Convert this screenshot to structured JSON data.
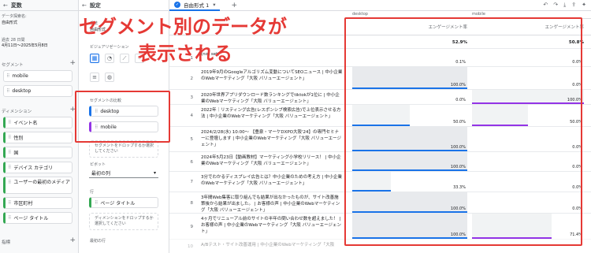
{
  "variables_panel": {
    "title": "変数",
    "exploration_name_label": "データ探索名:",
    "exploration_name": "自由形式",
    "date_label": "過去 28 日間",
    "date_range": "4月11日～2025年5月8日",
    "segments_label": "セグメント",
    "segments": [
      "mobile",
      "desktop"
    ],
    "dimensions_label": "ディメンション",
    "dimensions": [
      "イベント名",
      "性別",
      "国",
      "デバイス カテゴリ",
      "ユーザーの最初のメディア",
      "市区町村",
      "ページ タイトル"
    ],
    "metrics_label": "指標"
  },
  "settings_panel": {
    "title": "設定",
    "technique_label": "手法",
    "technique_value": "自由形式",
    "viz_label": "ビジュアリゼーション",
    "segment_compare_label": "セグメントの比較",
    "segment_compare": [
      "desktop",
      "mobile"
    ],
    "segment_drop_hint": "セグメントをドロップするか選択してください",
    "pivot_label": "ピボット",
    "pivot_value": "最初の列",
    "rows_label": "行",
    "rows_item": "ページ タイトル",
    "rows_drop_hint": "ディメンションをドロップするか選択してください",
    "start_row_label": "最初の行"
  },
  "canvas": {
    "tab_label": "自由形式 1",
    "toolbar_icons": [
      "undo-icon",
      "redo-icon",
      "download-icon",
      "share-icon",
      "insights-icon"
    ],
    "segments": [
      "desktop",
      "mobile"
    ],
    "metric_label": "エンゲージメント率",
    "totals": [
      "52.9%",
      "50.8%"
    ],
    "rows": [
      {
        "num": "1",
        "title": "(not set)",
        "desktop": "0.1%",
        "mobile": "0.0%"
      },
      {
        "num": "2",
        "title": "2019年9月のGoogleアルゴリズム変動についてSEOニュース | 中小企業のWebマーケティング「大阪 バリューエージェント」",
        "desktop": "100.0%",
        "mobile": "0.0%"
      },
      {
        "num": "3",
        "title": "2020年世界アプリダウンロード数ランキングでtiktokが1位に | 中小企業のWebマーケティング「大阪 バリューエージェント」",
        "desktop": "0.0%",
        "mobile": "100.0%"
      },
      {
        "num": "4",
        "title": "2022年｜リスティング広告(レスポンシブ検索広告)で上位表示させる方法 | 中小企業のWebマーケティング「大阪 バリューエージェント」",
        "desktop": "50.0%",
        "mobile": "50.0%"
      },
      {
        "num": "5",
        "title": "2024/2/28(水) 10:00～ 【豊泉・マーケDXPO大阪'24】の専門セミナーに登壇します | 中小企業のWebマーケティング「大阪 バリューエージェント」",
        "desktop": "100.0%",
        "mobile": "0.0%"
      },
      {
        "num": "6",
        "title": "2024年5月23日【動画教材】マーケティング小学校リリース！ | 中小企業のWebマーケティング「大阪 バリューエージェント」",
        "desktop": "100.0%",
        "mobile": "0.0%"
      },
      {
        "num": "7",
        "title": "3分でわかるディスプレイ広告とは？中小企業のための考え方 | 中小企業のWebマーケティング「大阪 バリューエージェント」",
        "desktop": "33.3%",
        "mobile": "0.0%"
      },
      {
        "num": "8",
        "title": "3年間Web集客に取り組んでも結果が出なかったものが、サイト改善施策後から結果が出ました。 | お客様の声 | 中小企業のWebマーケティング「大阪 バリューエージェント」",
        "desktop": "100.0%",
        "mobile": "0.0%"
      },
      {
        "num": "9",
        "title": "4ヶ月でリニューアル前のサイトの半年の問い合わせ数を超えました！ | お客様の声 | 中小企業のWebマーケティング「大阪 バリューエージェント」",
        "desktop": "100.0%",
        "mobile": "71.4%"
      },
      {
        "num": "10",
        "title": "A/Bテスト・サイト改善運用 | 中小企業のWebマーケティング「大阪",
        "desktop": "",
        "mobile": ""
      }
    ],
    "bars": {
      "desktop_fill": [
        0.001,
        1.0,
        0.0,
        0.5,
        1.0,
        1.0,
        0.333,
        1.0,
        1.0
      ],
      "mobile_fill": [
        0.0,
        0.0,
        1.0,
        0.5,
        0.0,
        0.0,
        0.0,
        0.0,
        0.714
      ]
    }
  },
  "overlay": {
    "line1": "セグメント別のデータが",
    "line2": "表示される"
  },
  "colors": {
    "accent": "#1a73e8",
    "annotation_red": "#e53935",
    "segment_desktop": "#1a73e8",
    "segment_mobile": "#9334e6"
  }
}
